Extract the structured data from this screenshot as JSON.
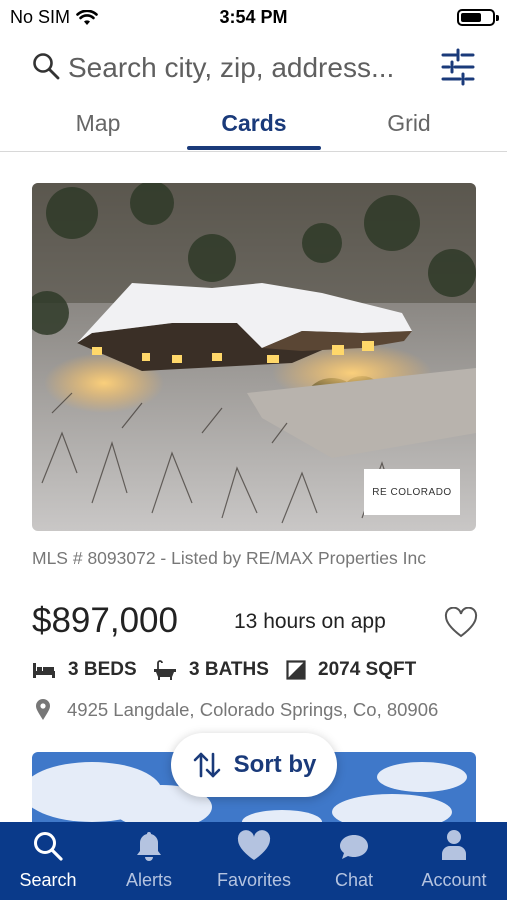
{
  "status_bar": {
    "carrier": "No SIM",
    "time": "3:54 PM"
  },
  "search": {
    "placeholder": "Search city, zip, address..."
  },
  "tabs": [
    {
      "label": "Map",
      "active": false
    },
    {
      "label": "Cards",
      "active": true
    },
    {
      "label": "Grid",
      "active": false
    }
  ],
  "listing": {
    "photo_logo_text": "RE COLORADO",
    "mls": "MLS # 8093072 - Listed by RE/MAX Properties Inc",
    "price": "$897,000",
    "time_on_app": "13 hours on app",
    "beds": "3 BEDS",
    "baths": "3 BATHS",
    "sqft": "2074 SQFT",
    "address": "4925 Langdale, Colorado Springs, Co, 80906"
  },
  "sort_button": {
    "label": "Sort by"
  },
  "bottom_nav": [
    {
      "label": "Search",
      "icon": "search-icon",
      "active": true
    },
    {
      "label": "Alerts",
      "icon": "bell-icon",
      "active": false
    },
    {
      "label": "Favorites",
      "icon": "heart-icon",
      "active": false
    },
    {
      "label": "Chat",
      "icon": "chat-icon",
      "active": false
    },
    {
      "label": "Account",
      "icon": "person-icon",
      "active": false
    }
  ],
  "colors": {
    "brand": "#0a3a8a",
    "accent": "#1a3a7a",
    "muted_text": "#777777"
  }
}
